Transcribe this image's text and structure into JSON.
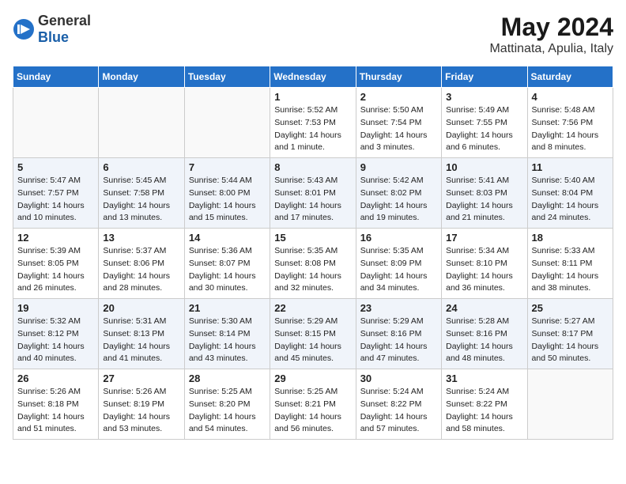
{
  "header": {
    "logo_general": "General",
    "logo_blue": "Blue",
    "month_title": "May 2024",
    "location": "Mattinata, Apulia, Italy"
  },
  "days_of_week": [
    "Sunday",
    "Monday",
    "Tuesday",
    "Wednesday",
    "Thursday",
    "Friday",
    "Saturday"
  ],
  "weeks": [
    [
      {
        "day": "",
        "info": ""
      },
      {
        "day": "",
        "info": ""
      },
      {
        "day": "",
        "info": ""
      },
      {
        "day": "1",
        "sunrise": "Sunrise: 5:52 AM",
        "sunset": "Sunset: 7:53 PM",
        "daylight": "Daylight: 14 hours and 1 minute."
      },
      {
        "day": "2",
        "sunrise": "Sunrise: 5:50 AM",
        "sunset": "Sunset: 7:54 PM",
        "daylight": "Daylight: 14 hours and 3 minutes."
      },
      {
        "day": "3",
        "sunrise": "Sunrise: 5:49 AM",
        "sunset": "Sunset: 7:55 PM",
        "daylight": "Daylight: 14 hours and 6 minutes."
      },
      {
        "day": "4",
        "sunrise": "Sunrise: 5:48 AM",
        "sunset": "Sunset: 7:56 PM",
        "daylight": "Daylight: 14 hours and 8 minutes."
      }
    ],
    [
      {
        "day": "5",
        "sunrise": "Sunrise: 5:47 AM",
        "sunset": "Sunset: 7:57 PM",
        "daylight": "Daylight: 14 hours and 10 minutes."
      },
      {
        "day": "6",
        "sunrise": "Sunrise: 5:45 AM",
        "sunset": "Sunset: 7:58 PM",
        "daylight": "Daylight: 14 hours and 13 minutes."
      },
      {
        "day": "7",
        "sunrise": "Sunrise: 5:44 AM",
        "sunset": "Sunset: 8:00 PM",
        "daylight": "Daylight: 14 hours and 15 minutes."
      },
      {
        "day": "8",
        "sunrise": "Sunrise: 5:43 AM",
        "sunset": "Sunset: 8:01 PM",
        "daylight": "Daylight: 14 hours and 17 minutes."
      },
      {
        "day": "9",
        "sunrise": "Sunrise: 5:42 AM",
        "sunset": "Sunset: 8:02 PM",
        "daylight": "Daylight: 14 hours and 19 minutes."
      },
      {
        "day": "10",
        "sunrise": "Sunrise: 5:41 AM",
        "sunset": "Sunset: 8:03 PM",
        "daylight": "Daylight: 14 hours and 21 minutes."
      },
      {
        "day": "11",
        "sunrise": "Sunrise: 5:40 AM",
        "sunset": "Sunset: 8:04 PM",
        "daylight": "Daylight: 14 hours and 24 minutes."
      }
    ],
    [
      {
        "day": "12",
        "sunrise": "Sunrise: 5:39 AM",
        "sunset": "Sunset: 8:05 PM",
        "daylight": "Daylight: 14 hours and 26 minutes."
      },
      {
        "day": "13",
        "sunrise": "Sunrise: 5:37 AM",
        "sunset": "Sunset: 8:06 PM",
        "daylight": "Daylight: 14 hours and 28 minutes."
      },
      {
        "day": "14",
        "sunrise": "Sunrise: 5:36 AM",
        "sunset": "Sunset: 8:07 PM",
        "daylight": "Daylight: 14 hours and 30 minutes."
      },
      {
        "day": "15",
        "sunrise": "Sunrise: 5:35 AM",
        "sunset": "Sunset: 8:08 PM",
        "daylight": "Daylight: 14 hours and 32 minutes."
      },
      {
        "day": "16",
        "sunrise": "Sunrise: 5:35 AM",
        "sunset": "Sunset: 8:09 PM",
        "daylight": "Daylight: 14 hours and 34 minutes."
      },
      {
        "day": "17",
        "sunrise": "Sunrise: 5:34 AM",
        "sunset": "Sunset: 8:10 PM",
        "daylight": "Daylight: 14 hours and 36 minutes."
      },
      {
        "day": "18",
        "sunrise": "Sunrise: 5:33 AM",
        "sunset": "Sunset: 8:11 PM",
        "daylight": "Daylight: 14 hours and 38 minutes."
      }
    ],
    [
      {
        "day": "19",
        "sunrise": "Sunrise: 5:32 AM",
        "sunset": "Sunset: 8:12 PM",
        "daylight": "Daylight: 14 hours and 40 minutes."
      },
      {
        "day": "20",
        "sunrise": "Sunrise: 5:31 AM",
        "sunset": "Sunset: 8:13 PM",
        "daylight": "Daylight: 14 hours and 41 minutes."
      },
      {
        "day": "21",
        "sunrise": "Sunrise: 5:30 AM",
        "sunset": "Sunset: 8:14 PM",
        "daylight": "Daylight: 14 hours and 43 minutes."
      },
      {
        "day": "22",
        "sunrise": "Sunrise: 5:29 AM",
        "sunset": "Sunset: 8:15 PM",
        "daylight": "Daylight: 14 hours and 45 minutes."
      },
      {
        "day": "23",
        "sunrise": "Sunrise: 5:29 AM",
        "sunset": "Sunset: 8:16 PM",
        "daylight": "Daylight: 14 hours and 47 minutes."
      },
      {
        "day": "24",
        "sunrise": "Sunrise: 5:28 AM",
        "sunset": "Sunset: 8:16 PM",
        "daylight": "Daylight: 14 hours and 48 minutes."
      },
      {
        "day": "25",
        "sunrise": "Sunrise: 5:27 AM",
        "sunset": "Sunset: 8:17 PM",
        "daylight": "Daylight: 14 hours and 50 minutes."
      }
    ],
    [
      {
        "day": "26",
        "sunrise": "Sunrise: 5:26 AM",
        "sunset": "Sunset: 8:18 PM",
        "daylight": "Daylight: 14 hours and 51 minutes."
      },
      {
        "day": "27",
        "sunrise": "Sunrise: 5:26 AM",
        "sunset": "Sunset: 8:19 PM",
        "daylight": "Daylight: 14 hours and 53 minutes."
      },
      {
        "day": "28",
        "sunrise": "Sunrise: 5:25 AM",
        "sunset": "Sunset: 8:20 PM",
        "daylight": "Daylight: 14 hours and 54 minutes."
      },
      {
        "day": "29",
        "sunrise": "Sunrise: 5:25 AM",
        "sunset": "Sunset: 8:21 PM",
        "daylight": "Daylight: 14 hours and 56 minutes."
      },
      {
        "day": "30",
        "sunrise": "Sunrise: 5:24 AM",
        "sunset": "Sunset: 8:22 PM",
        "daylight": "Daylight: 14 hours and 57 minutes."
      },
      {
        "day": "31",
        "sunrise": "Sunrise: 5:24 AM",
        "sunset": "Sunset: 8:22 PM",
        "daylight": "Daylight: 14 hours and 58 minutes."
      },
      {
        "day": "",
        "info": ""
      }
    ]
  ]
}
